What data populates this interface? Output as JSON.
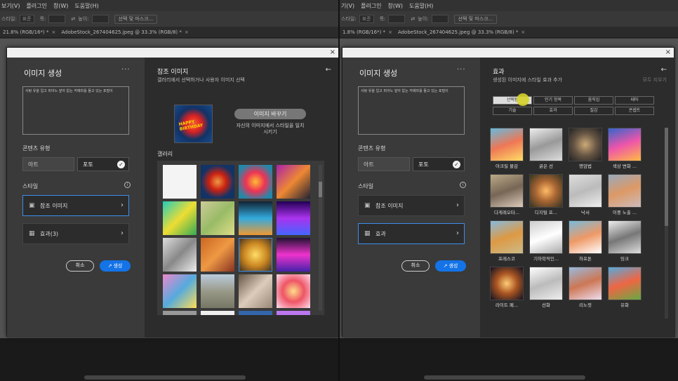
{
  "left": {
    "menu": [
      "보기(V)",
      "플러그인",
      "창(W)",
      "도움말(H)"
    ],
    "options": {
      "style_label": "스타일:",
      "style_value": "표준",
      "width_label": "폭:",
      "height_label": "높이:",
      "select_mask": "선택 및 마스크..."
    },
    "tabs": [
      {
        "label": "21.8% (RGB/16*) *",
        "close": "×"
      },
      {
        "label": "AdobeStock_267404625.jpeg @ 33.3% (RGB/8) *",
        "close": "×"
      }
    ],
    "dialog": {
      "close": "×",
      "title": "이미지 생성",
      "more": "···",
      "prompt": "사탕 유을 입고 피아노 앞아 없는 카메라를 들고 있는 포털이",
      "content_type_label": "콘텐츠 유형",
      "art": "아트",
      "photo": "포토",
      "check": "✓",
      "style_label": "스타일",
      "info": "i",
      "style_items": [
        "참조 이미지",
        "효과(3)"
      ],
      "chevron": "›",
      "cancel": "취소",
      "generate": "생성",
      "generate_icon": "↗",
      "panel": {
        "title": "참조 이미지",
        "subtitle": "갤러리에서 선택하거나 사용자 이미지 선택",
        "back": "←",
        "replace": "이미지 바꾸기",
        "hint": "자신의 이미지에서 스타일을 일치시키기",
        "gallery_label": "갤러리",
        "thumb_text": "HAPPY BIRTHDAY"
      }
    }
  },
  "right": {
    "menu": [
      "기(V)",
      "플러그인",
      "창(W)",
      "도움말(H)"
    ],
    "options": {
      "style_label": "스타일:",
      "style_value": "표준",
      "width_label": "폭:",
      "height_label": "높이:",
      "select_mask": "선택 및 마스크..."
    },
    "tabs": [
      {
        "label": "1.8% (RGB/16*) *",
        "close": "×"
      },
      {
        "label": "AdobeStock_267404625.jpeg @ 33.3% (RGB/8) *",
        "close": "×"
      }
    ],
    "dialog": {
      "close": "×",
      "title": "이미지 생성",
      "more": "···",
      "prompt": "사탕 유을 입고 피아노 앞아 없는 카메라를 들고 있는 포털이",
      "content_type_label": "콘텐츠 유형",
      "art": "아트",
      "photo": "포토",
      "check": "✓",
      "style_label": "스타일",
      "info": "i",
      "style_items": [
        "참조 이미지",
        "효과"
      ],
      "chevron": "›",
      "cancel": "취소",
      "generate": "생성",
      "generate_icon": "↗",
      "panel": {
        "title": "효과",
        "subtitle": "생성된 이미지에 스타일 효과 추가",
        "back": "←",
        "reset": "모두 지우기",
        "filters": [
          "선택됨",
          "인기 항목",
          "움직임",
          "테마",
          "기술",
          "효과",
          "질감",
          "콘셉트"
        ],
        "effects": [
          "아크릴 물감",
          "굵은 선",
          "명암법",
          "색상 변화 ...",
          "다게레오타...",
          "디지털 프...",
          "낙서",
          "이중 노출 ...",
          "프레스코",
          "기하학적인...",
          "하프톤",
          "잉크",
          "라이트 페...",
          "선화",
          "리노컷",
          "유화"
        ]
      }
    }
  }
}
